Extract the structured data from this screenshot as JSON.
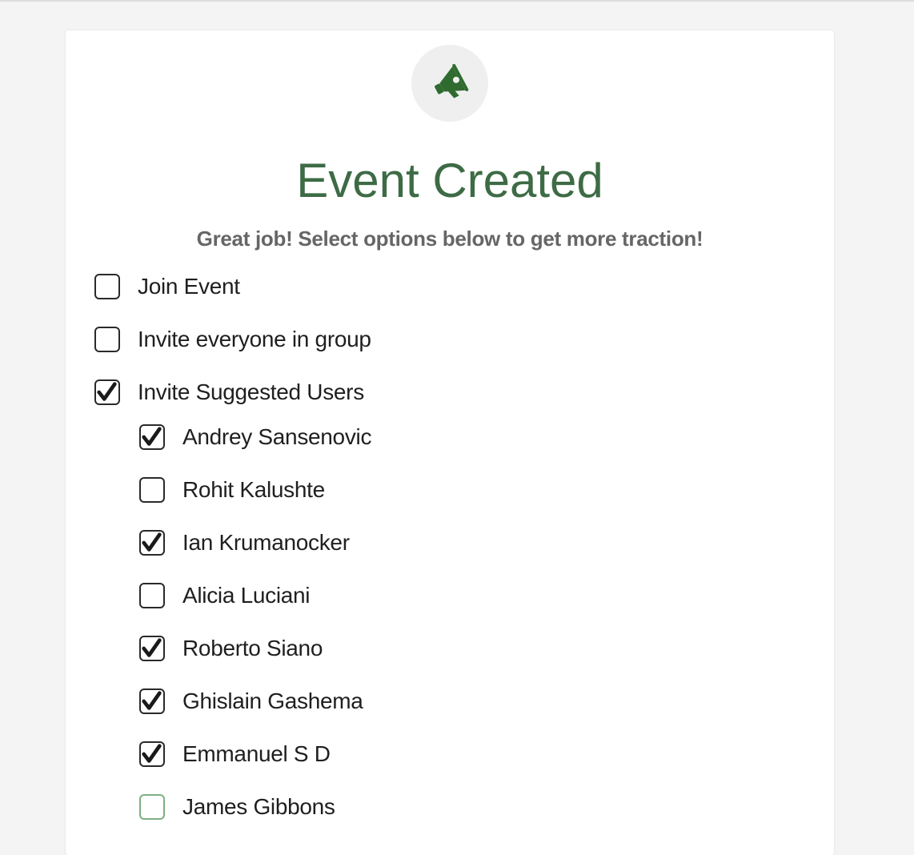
{
  "icon": "megaphone-icon",
  "colors": {
    "accent": "#3d6b45",
    "subtitle": "#666666",
    "checkbox_hover": "#7cb083"
  },
  "title": "Event Created",
  "subtitle": "Great job! Select options below to get more traction!",
  "options": [
    {
      "label": "Join Event",
      "checked": false
    },
    {
      "label": "Invite everyone in group",
      "checked": false
    },
    {
      "label": "Invite Suggested Users",
      "checked": true
    }
  ],
  "suggested_users": [
    {
      "label": "Andrey Sansenovic",
      "checked": true
    },
    {
      "label": "Rohit Kalushte",
      "checked": false
    },
    {
      "label": "Ian Krumanocker",
      "checked": true
    },
    {
      "label": "Alicia Luciani",
      "checked": false
    },
    {
      "label": "Roberto Siano",
      "checked": true
    },
    {
      "label": "Ghislain Gashema",
      "checked": true
    },
    {
      "label": "Emmanuel S D",
      "checked": true
    },
    {
      "label": "James Gibbons",
      "checked": false,
      "hover": true
    }
  ]
}
